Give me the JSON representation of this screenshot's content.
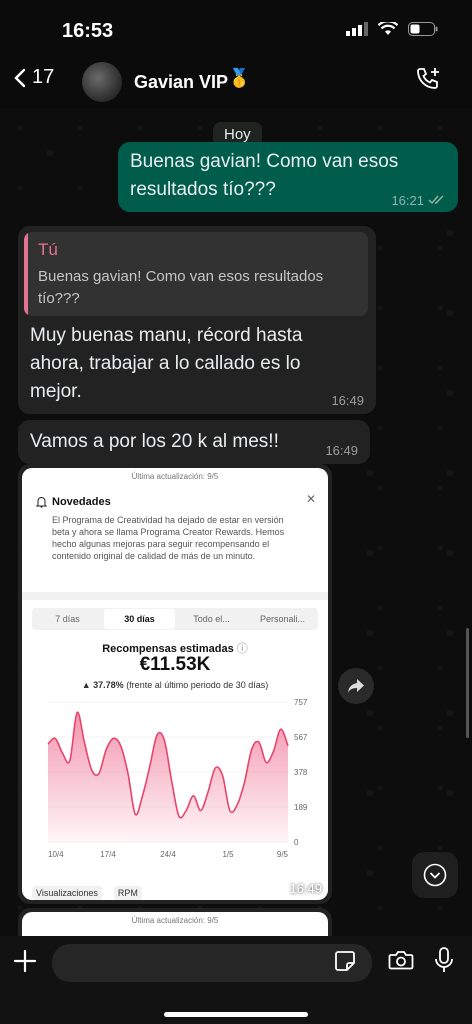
{
  "status_bar": {
    "time": "16:53"
  },
  "header": {
    "back_count": "17",
    "contact_name": "Gavian VIP",
    "badge_emoji": "🥇"
  },
  "chat": {
    "date_label": "Hoy",
    "messages": [
      {
        "direction": "out",
        "text": "Buenas gavian! Como van esos resultados tío???",
        "time": "16:21"
      },
      {
        "direction": "in",
        "reply_author": "Tú",
        "reply_text": "Buenas gavian! Como van esos resultados tío???",
        "text": "Muy buenas manu, récord hasta ahora, trabajar a lo callado es lo mejor.",
        "time": "16:49"
      },
      {
        "direction": "in",
        "text": "Vamos a por los 20 k al mes!!",
        "time": "16:49"
      },
      {
        "direction": "in",
        "type": "image",
        "time": "16:49"
      }
    ]
  },
  "screenshot_content": {
    "last_update": "Última actualización: 9/5",
    "news_title": "Novedades",
    "news_text": "El Programa de Creatividad ha dejado de estar en versión beta y ahora se llama Programa Creator Rewards. Hemos hecho algunas mejoras para seguir recompensando el contenido original de calidad de más de un minuto.",
    "tabs": [
      "7 días",
      "30 días",
      "Todo el...",
      "Personali..."
    ],
    "chart_title": "Recompensas estimadas",
    "total": "€11.53K",
    "change": "37.78%",
    "change_note": "(frente al último periodo de 30 días)",
    "bottom_tabs": [
      "Visualizaciones",
      "RPM"
    ]
  },
  "chart_data": {
    "type": "area",
    "x_ticks": [
      "10/4",
      "17/4",
      "24/4",
      "1/5",
      "9/5"
    ],
    "y_ticks": [
      "757",
      "567",
      "378",
      "189",
      "0"
    ],
    "ylim": [
      0,
      757
    ],
    "values": [
      530,
      560,
      480,
      440,
      700,
      540,
      390,
      370,
      500,
      560,
      520,
      370,
      150,
      250,
      410,
      580,
      550,
      330,
      140,
      170,
      250,
      170,
      270,
      400,
      360,
      170,
      200,
      320,
      500,
      540,
      430,
      490,
      610,
      520
    ],
    "colors": {
      "line": "#e8456b",
      "fill_top": "#f28aa6"
    }
  },
  "input": {
    "placeholder": ""
  },
  "colors": {
    "outgoing_bubble": "#005c4b",
    "incoming_bubble": "#222222",
    "accent": "#e37392"
  }
}
